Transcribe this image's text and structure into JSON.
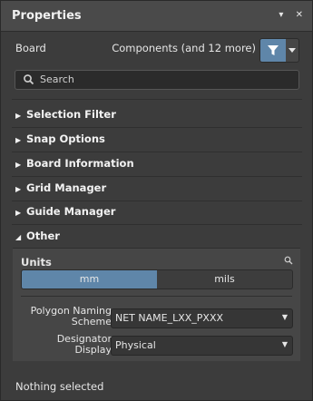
{
  "panel": {
    "title": "Properties",
    "icons": {
      "pin": "pin-icon",
      "close": "close-icon"
    },
    "close_glyph": "✕",
    "pin_glyph": "▾"
  },
  "header": {
    "object_type": "Board",
    "filter_scope": "Components (and 12 more)"
  },
  "search": {
    "placeholder": "Search"
  },
  "sections": [
    {
      "label": "Selection Filter",
      "expanded": false
    },
    {
      "label": "Snap Options",
      "expanded": false
    },
    {
      "label": "Board Information",
      "expanded": false
    },
    {
      "label": "Grid Manager",
      "expanded": false
    },
    {
      "label": "Guide Manager",
      "expanded": false
    },
    {
      "label": "Other",
      "expanded": true
    }
  ],
  "other": {
    "units_label": "Units",
    "units_options": [
      "mm",
      "mils"
    ],
    "units_selected": "mm",
    "polygon_naming_label_line1": "Polygon Naming",
    "polygon_naming_label_line2": "Scheme",
    "polygon_naming_value": "NET NAME_LXX_PXXX",
    "designator_label_line1": "Designator",
    "designator_label_line2": "Display",
    "designator_value": "Physical"
  },
  "status": {
    "text": "Nothing selected"
  },
  "colors": {
    "accent": "#5f86a9",
    "panel_bg": "#3c3c3c",
    "titlebar_bg": "#4a4a4a"
  }
}
